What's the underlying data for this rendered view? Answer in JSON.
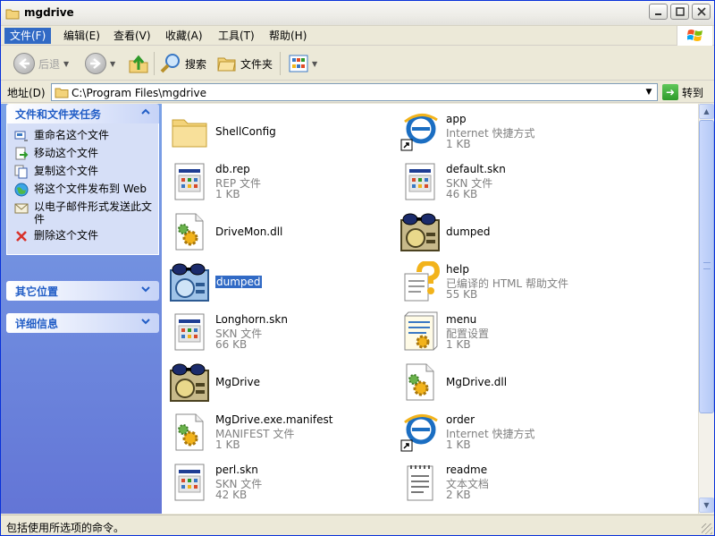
{
  "window": {
    "title": "mgdrive"
  },
  "menu": [
    {
      "label": "文件(F)",
      "active": true
    },
    {
      "label": "编辑(E)"
    },
    {
      "label": "查看(V)"
    },
    {
      "label": "收藏(A)"
    },
    {
      "label": "工具(T)"
    },
    {
      "label": "帮助(H)"
    }
  ],
  "toolbar": {
    "back": "后退",
    "search": "搜索",
    "folders": "文件夹"
  },
  "address": {
    "label": "地址(D)",
    "path": "C:\\Program Files\\mgdrive",
    "go": "转到"
  },
  "taskpane": {
    "file_tasks": {
      "title": "文件和文件夹任务",
      "items": [
        {
          "label": "重命名这个文件",
          "icon": "rename-icon"
        },
        {
          "label": "移动这个文件",
          "icon": "move-icon"
        },
        {
          "label": "复制这个文件",
          "icon": "copy-icon"
        },
        {
          "label": "将这个文件发布到 Web",
          "icon": "publish-web-icon"
        },
        {
          "label": "以电子邮件形式发送此文件",
          "icon": "email-icon"
        },
        {
          "label": "删除这个文件",
          "icon": "delete-icon"
        }
      ]
    },
    "other_places": {
      "title": "其它位置"
    },
    "details": {
      "title": "详细信息"
    }
  },
  "files": [
    {
      "name": "ShellConfig",
      "type": "",
      "size": "",
      "icon": "folder-icon"
    },
    {
      "name": "app",
      "type": "Internet 快捷方式",
      "size": "1 KB",
      "icon": "internet-shortcut-icon"
    },
    {
      "name": "db.rep",
      "type": "REP 文件",
      "size": "1 KB",
      "icon": "generic-file-icon"
    },
    {
      "name": "default.skn",
      "type": "SKN 文件",
      "size": "46 KB",
      "icon": "generic-file-icon"
    },
    {
      "name": "DriveMon.dll",
      "type": "",
      "size": "",
      "icon": "dll-gear-icon"
    },
    {
      "name": "dumped",
      "type": "",
      "size": "",
      "icon": "mgdrive-app-icon"
    },
    {
      "name": "dumped",
      "type": "",
      "size": "",
      "icon": "mgdrive-app-icon",
      "selected": true
    },
    {
      "name": "help",
      "type": "已编译的 HTML 帮助文件",
      "size": "55 KB",
      "icon": "chm-help-icon"
    },
    {
      "name": "Longhorn.skn",
      "type": "SKN 文件",
      "size": "66 KB",
      "icon": "generic-file-icon"
    },
    {
      "name": "menu",
      "type": "配置设置",
      "size": "1 KB",
      "icon": "config-settings-icon"
    },
    {
      "name": "MgDrive",
      "type": "",
      "size": "",
      "icon": "mgdrive-app-icon"
    },
    {
      "name": "MgDrive.dll",
      "type": "",
      "size": "",
      "icon": "dll-gear-icon"
    },
    {
      "name": "MgDrive.exe.manifest",
      "type": "MANIFEST 文件",
      "size": "1 KB",
      "icon": "dll-gear-icon"
    },
    {
      "name": "order",
      "type": "Internet 快捷方式",
      "size": "1 KB",
      "icon": "internet-shortcut-icon"
    },
    {
      "name": "perl.skn",
      "type": "SKN 文件",
      "size": "42 KB",
      "icon": "generic-file-icon"
    },
    {
      "name": "readme",
      "type": "文本文档",
      "size": "2 KB",
      "icon": "text-document-icon"
    }
  ],
  "status": {
    "text": "包括使用所选项的命令。"
  }
}
